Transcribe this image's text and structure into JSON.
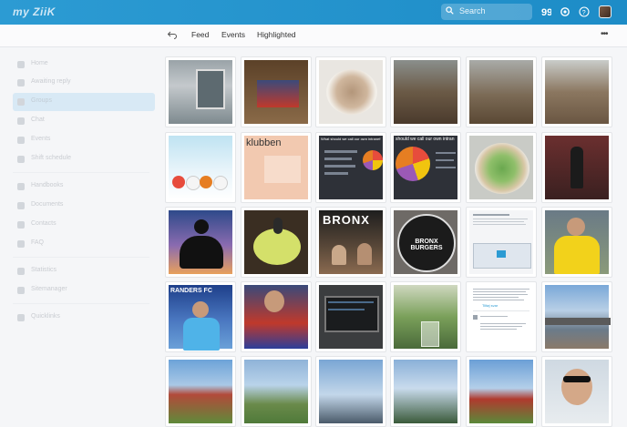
{
  "app": {
    "logo_text": "my ZiiK"
  },
  "search": {
    "placeholder": "Search"
  },
  "toolbar_icons": [
    "search-icon",
    "quote-icon",
    "gear-icon",
    "help-icon"
  ],
  "subnav": {
    "tabs": [
      {
        "label": "Feed"
      },
      {
        "label": "Events"
      },
      {
        "label": "Highlighted"
      }
    ],
    "more_label": "•••"
  },
  "sidebar": {
    "items": [
      {
        "label": "Home",
        "icon": "home-icon"
      },
      {
        "label": "Awaiting reply",
        "icon": "bell-icon"
      },
      {
        "label": "Groups",
        "icon": "groups-icon",
        "active": true
      },
      {
        "label": "Chat",
        "icon": "chat-icon"
      },
      {
        "label": "Events",
        "icon": "calendar-icon"
      },
      {
        "label": "Shift schedule",
        "icon": "schedule-icon"
      },
      {
        "label": "Handbooks",
        "icon": "book-icon"
      },
      {
        "label": "Documents",
        "icon": "document-icon"
      },
      {
        "label": "Contacts",
        "icon": "contacts-icon"
      },
      {
        "label": "FAQ",
        "icon": "faq-icon"
      },
      {
        "label": "Statistics",
        "icon": "statistics-icon"
      },
      {
        "label": "Sitemanager",
        "icon": "sitemanager-icon"
      },
      {
        "label": "Quicklinks",
        "icon": "link-icon"
      }
    ]
  },
  "gallery": {
    "texts": {
      "klubben": "klubben",
      "slide_a": "What should we call our own intranet?",
      "slide_b": "should we call our own intran",
      "bronx": "BRONX",
      "burgers": "BRONX BURGERS",
      "randers": "RANDERS FC",
      "wall_reply": "Tilføj svar"
    },
    "colors": {
      "accent": "#2c9bd3",
      "sidebar_active": "#d8e9f5"
    }
  }
}
